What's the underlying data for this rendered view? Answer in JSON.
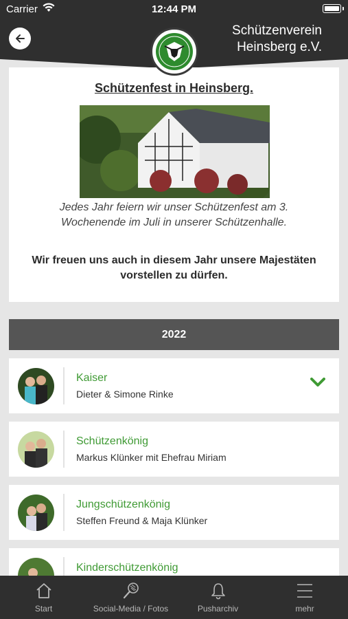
{
  "status": {
    "carrier": "Carrier",
    "time": "12:44 PM"
  },
  "header": {
    "title_line1": "Schützenverein",
    "title_line2": "Heinsberg e.V."
  },
  "intro": {
    "title": "Schützenfest in Heinsberg.",
    "text": "Jedes Jahr feiern wir unser Schützenfest am 3. Wochenende im Juli in unserer Schützenhalle.",
    "bold_text": "Wir freuen uns auch in diesem Jahr unsere Majestäten vorstellen zu dürfen."
  },
  "year": "2022",
  "majesties": [
    {
      "title": "Kaiser",
      "names": "Dieter & Simone Rinke"
    },
    {
      "title": "Schützenkönig",
      "names": "Markus Klünker mit Ehefrau Miriam"
    },
    {
      "title": "Jungschützenkönig",
      "names": "Steffen Freund & Maja Klünker"
    },
    {
      "title": "Kinderschützenkönig",
      "names": ""
    }
  ],
  "tabs": [
    {
      "label": "Start",
      "icon": "home-icon"
    },
    {
      "label": "Social-Media / Fotos",
      "icon": "camera-icon"
    },
    {
      "label": "Pusharchiv",
      "icon": "bell-icon"
    },
    {
      "label": "mehr",
      "icon": "menu-icon"
    }
  ],
  "colors": {
    "dark": "#2f2f2f",
    "accent_green": "#3f9a34",
    "year_bar": "#555555",
    "background": "#e6e6e6"
  }
}
